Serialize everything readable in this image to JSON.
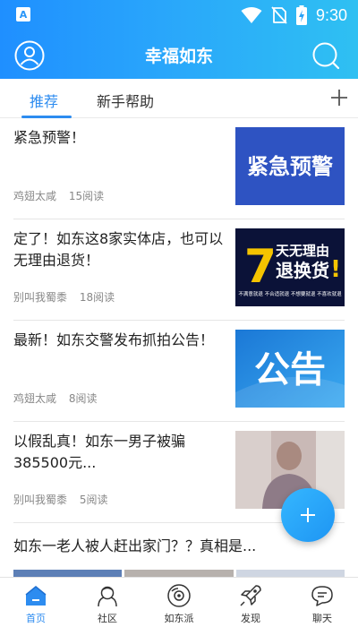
{
  "status_bar": {
    "time": "9:30",
    "app_badge": "A"
  },
  "header": {
    "title": "幸福如东"
  },
  "tabs": [
    {
      "label": "推荐",
      "active": true
    },
    {
      "label": "新手帮助",
      "active": false
    }
  ],
  "feed": [
    {
      "title": "紧急预警！",
      "author": "鸡翅太咸",
      "reads": "15阅读",
      "thumb_text": "紧急预警"
    },
    {
      "title": "定了！如东这8家实体店，也可以无理由退货！",
      "author": "别叫我蜀黍",
      "reads": "18阅读",
      "thumb_big": "7",
      "thumb_line1": "天无理由",
      "thumb_line2": "退换货",
      "thumb_mark": "!",
      "thumb_small": "不满意就退  不合适就退  不想要就退  不喜欢就退"
    },
    {
      "title": "最新！如东交警发布抓拍公告！",
      "author": "鸡翅太咸",
      "reads": "8阅读",
      "thumb_text": "公告"
    },
    {
      "title": "以假乱真！如东一男子被骗385500元...",
      "author": "别叫我蜀黍",
      "reads": "5阅读"
    },
    {
      "title": "如东一老人被人赶出家门？？真相是..."
    }
  ],
  "bottom_nav": [
    {
      "label": "首页",
      "icon": "home-icon",
      "active": true
    },
    {
      "label": "社区",
      "icon": "community-icon",
      "active": false
    },
    {
      "label": "如东派",
      "icon": "rudongpai-icon",
      "active": false
    },
    {
      "label": "发现",
      "icon": "discover-rocket-icon",
      "active": false
    },
    {
      "label": "聊天",
      "icon": "chat-icon",
      "active": false
    }
  ],
  "colors": {
    "accent": "#2d8cf0",
    "header_start": "#1f8fff",
    "header_end": "#2fc0f2"
  }
}
